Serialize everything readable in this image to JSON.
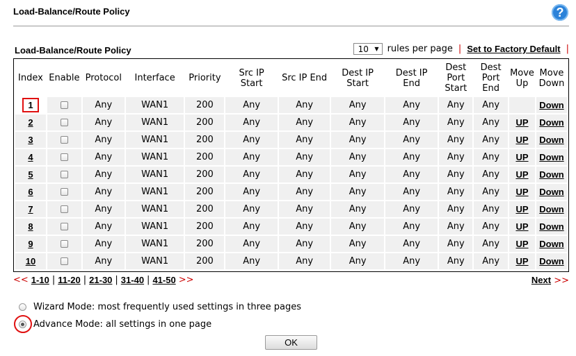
{
  "page": {
    "title": "Load-Balance/Route Policy"
  },
  "table": {
    "title": "Load-Balance/Route Policy",
    "rules_per_page_value": "10",
    "rules_per_page_label": "rules per page",
    "factory_default": "Set to Factory Default",
    "headers": {
      "index": "Index",
      "enable": "Enable",
      "protocol": "Protocol",
      "interface": "Interface",
      "priority": "Priority",
      "src_ip_start": [
        "Src IP",
        "Start"
      ],
      "src_ip_end": "Src IP End",
      "dest_ip_start": [
        "Dest IP",
        "Start"
      ],
      "dest_ip_end": [
        "Dest IP",
        "End"
      ],
      "dest_port_start": [
        "Dest",
        "Port",
        "Start"
      ],
      "dest_port_end": [
        "Dest",
        "Port",
        "End"
      ],
      "move_up": [
        "Move",
        "Up"
      ],
      "move_down": [
        "Move",
        "Down"
      ]
    },
    "rows": [
      {
        "index": "1",
        "protocol": "Any",
        "interface": "WAN1",
        "priority": "200",
        "src_start": "Any",
        "src_end": "Any",
        "dest_start": "Any",
        "dest_end": "Any",
        "port_start": "Any",
        "port_end": "Any",
        "up": "",
        "down": "Down"
      },
      {
        "index": "2",
        "protocol": "Any",
        "interface": "WAN1",
        "priority": "200",
        "src_start": "Any",
        "src_end": "Any",
        "dest_start": "Any",
        "dest_end": "Any",
        "port_start": "Any",
        "port_end": "Any",
        "up": "UP",
        "down": "Down"
      },
      {
        "index": "3",
        "protocol": "Any",
        "interface": "WAN1",
        "priority": "200",
        "src_start": "Any",
        "src_end": "Any",
        "dest_start": "Any",
        "dest_end": "Any",
        "port_start": "Any",
        "port_end": "Any",
        "up": "UP",
        "down": "Down"
      },
      {
        "index": "4",
        "protocol": "Any",
        "interface": "WAN1",
        "priority": "200",
        "src_start": "Any",
        "src_end": "Any",
        "dest_start": "Any",
        "dest_end": "Any",
        "port_start": "Any",
        "port_end": "Any",
        "up": "UP",
        "down": "Down"
      },
      {
        "index": "5",
        "protocol": "Any",
        "interface": "WAN1",
        "priority": "200",
        "src_start": "Any",
        "src_end": "Any",
        "dest_start": "Any",
        "dest_end": "Any",
        "port_start": "Any",
        "port_end": "Any",
        "up": "UP",
        "down": "Down"
      },
      {
        "index": "6",
        "protocol": "Any",
        "interface": "WAN1",
        "priority": "200",
        "src_start": "Any",
        "src_end": "Any",
        "dest_start": "Any",
        "dest_end": "Any",
        "port_start": "Any",
        "port_end": "Any",
        "up": "UP",
        "down": "Down"
      },
      {
        "index": "7",
        "protocol": "Any",
        "interface": "WAN1",
        "priority": "200",
        "src_start": "Any",
        "src_end": "Any",
        "dest_start": "Any",
        "dest_end": "Any",
        "port_start": "Any",
        "port_end": "Any",
        "up": "UP",
        "down": "Down"
      },
      {
        "index": "8",
        "protocol": "Any",
        "interface": "WAN1",
        "priority": "200",
        "src_start": "Any",
        "src_end": "Any",
        "dest_start": "Any",
        "dest_end": "Any",
        "port_start": "Any",
        "port_end": "Any",
        "up": "UP",
        "down": "Down"
      },
      {
        "index": "9",
        "protocol": "Any",
        "interface": "WAN1",
        "priority": "200",
        "src_start": "Any",
        "src_end": "Any",
        "dest_start": "Any",
        "dest_end": "Any",
        "port_start": "Any",
        "port_end": "Any",
        "up": "UP",
        "down": "Down"
      },
      {
        "index": "10",
        "protocol": "Any",
        "interface": "WAN1",
        "priority": "200",
        "src_start": "Any",
        "src_end": "Any",
        "dest_start": "Any",
        "dest_end": "Any",
        "port_start": "Any",
        "port_end": "Any",
        "up": "UP",
        "down": "Down"
      }
    ]
  },
  "pagination": {
    "prev": "<<",
    "ranges": [
      "1-10",
      "11-20",
      "21-30",
      "31-40",
      "41-50"
    ],
    "forward": ">>",
    "next": "Next",
    "next_arrow": ">>"
  },
  "modes": {
    "wizard": "Wizard Mode: most frequently used settings in three pages",
    "advance": "Advance Mode: all settings in one page",
    "selected": "advance"
  },
  "ok_label": "OK",
  "colors": {
    "highlight_red": "#e01010",
    "link_red": "#cc0000",
    "help_blue": "#2b82d9"
  },
  "icons": {
    "help": "question-mark-icon"
  }
}
